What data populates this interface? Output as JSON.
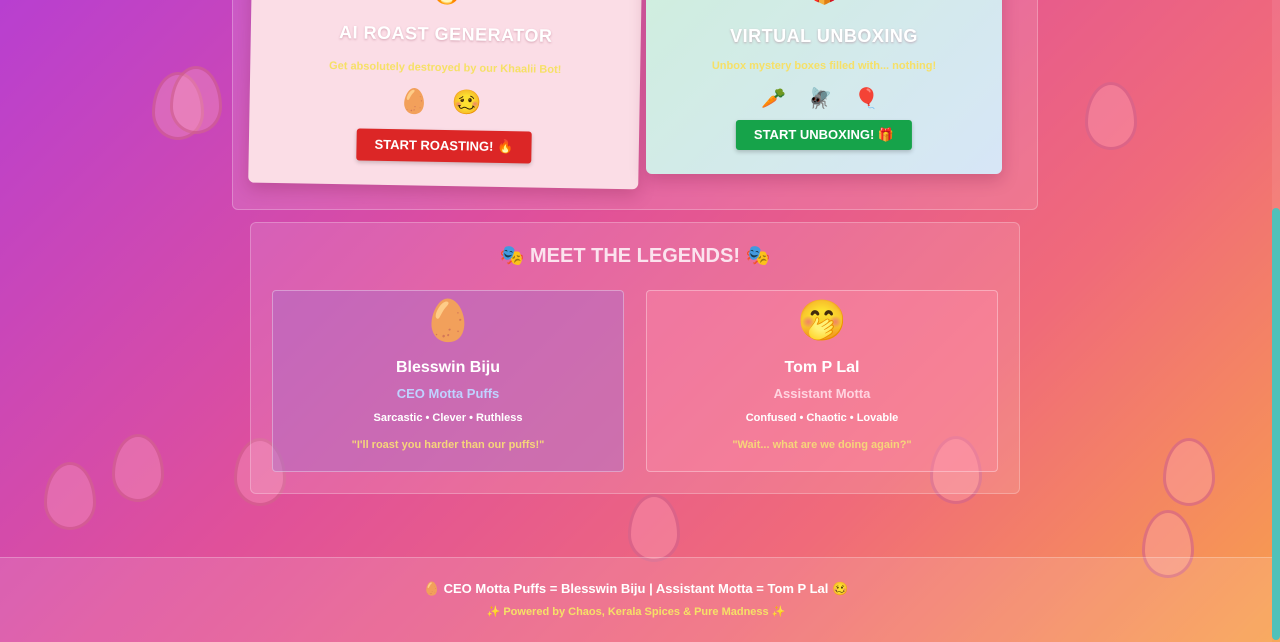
{
  "features": {
    "roast": {
      "icon": "🔥",
      "title": "AI ROAST GENERATOR",
      "subtitle": "Get absolutely destroyed by our Khaalii Bot!",
      "emojis": "🥚 🥴",
      "button": "START ROASTING! 🔥",
      "button_color": "#dc2626"
    },
    "unbox": {
      "icon": "🎁",
      "title": "VIRTUAL UNBOXING",
      "subtitle": "Unbox mystery boxes filled with... nothing!",
      "emojis": "🥕 🪰 🎈",
      "button": "START UNBOXING! 🎁",
      "button_color": "#16a34a"
    }
  },
  "legends": {
    "title": "🎭 MEET THE LEGENDS! 🎭",
    "people": [
      {
        "avatar": "🥚",
        "name": "Blesswin Biju",
        "role": "CEO Motta Puffs",
        "traits": "Sarcastic • Clever • Ruthless",
        "quote": "\"I'll roast you harder than our puffs!\""
      },
      {
        "avatar": "🤭",
        "name": "Tom P Lal",
        "role": "Assistant Motta",
        "traits": "Confused • Chaotic • Lovable",
        "quote": "\"Wait... what are we doing again?\""
      }
    ]
  },
  "footer": {
    "credits": "🥚 CEO Motta Puffs = Blesswin Biju | Assistant Motta = Tom P Lal 🥴",
    "powered": "✨ Powered by Chaos, Kerala Spices & Pure Madness ✨"
  },
  "colors": {
    "gradient_start": "#b83fd0",
    "gradient_end": "#f8a04c",
    "accent_yellow": "#f6e067",
    "scrollbar": "#4fc1b9"
  }
}
